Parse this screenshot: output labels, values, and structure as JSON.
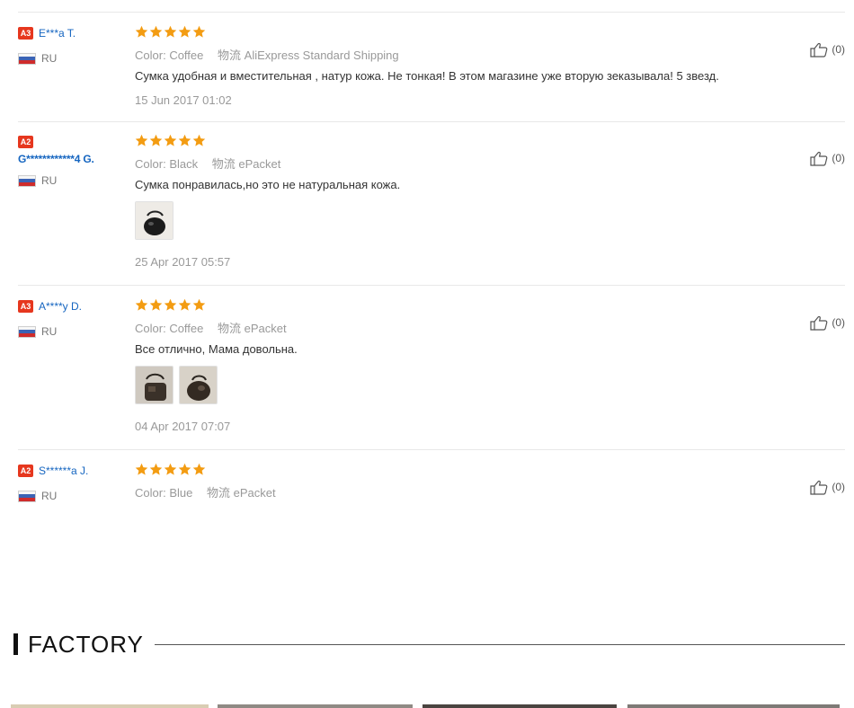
{
  "labels": {
    "color": "Color:",
    "shipping": "物流"
  },
  "reviews": [
    {
      "level": "A3",
      "name": "E***a T.",
      "country": "RU",
      "color": "Coffee",
      "shipping": "AliExpress Standard Shipping",
      "text": "Сумка удобная и вместительная , натур кожа. Не тонкая! В этом магазине уже вторую зеказывала! 5 звезд.",
      "date": "15 Jun 2017 01:02",
      "likes": "(0)",
      "rating": 5
    },
    {
      "level": "A2",
      "name": "G************4 G.",
      "country": "RU",
      "color": "Black",
      "shipping": "ePacket",
      "text": "Сумка понравилась,но это не натуральная кожа.",
      "date": "25 Apr 2017 05:57",
      "likes": "(0)",
      "rating": 5
    },
    {
      "level": "A3",
      "name": "A****y D.",
      "country": "RU",
      "color": "Coffee",
      "shipping": "ePacket",
      "text": "Все отлично, Мама довольна.",
      "date": "04 Apr 2017 07:07",
      "likes": "(0)",
      "rating": 5
    },
    {
      "level": "A2",
      "name": "S******a J.",
      "country": "RU",
      "color": "Blue",
      "shipping": "ePacket",
      "likes": "(0)",
      "rating": 5
    }
  ],
  "factory": {
    "title": "FACTORY"
  },
  "colors": {
    "star": "#f39c12",
    "badge": "#e6371e",
    "name": "#1565c0",
    "muted": "#999999"
  }
}
